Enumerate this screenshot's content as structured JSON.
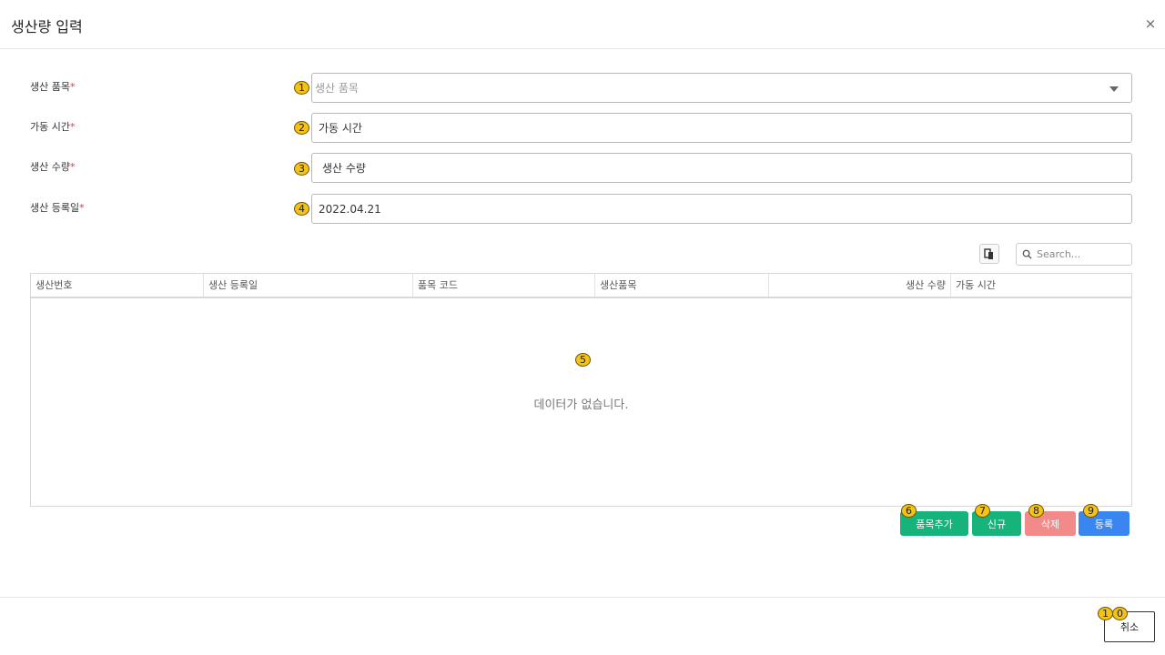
{
  "modal": {
    "title": "생산량 입력",
    "close_label": "×"
  },
  "form": {
    "product": {
      "label": "생산 품목",
      "required_mark": "*",
      "placeholder": "생산 품목",
      "marker": "1"
    },
    "hours": {
      "label": "가동 시간",
      "required_mark": "*",
      "value": "가동 시간",
      "marker": "2"
    },
    "quantity": {
      "label": "생산 수량",
      "required_mark": "*",
      "value": "생산 수량",
      "marker": "3"
    },
    "date": {
      "label": "생산 등록일",
      "required_mark": "*",
      "value": "2022.04.21",
      "marker": "4"
    }
  },
  "toolbar": {
    "export_icon": "export-icon",
    "search_placeholder": "Search...",
    "search_icon": "search-icon"
  },
  "table": {
    "columns": [
      "생산번호",
      "생산 등록일",
      "품목 코드",
      "생산품목",
      "생산 수량",
      "가동 시간"
    ],
    "rows": [],
    "empty_text": "데이터가 없습니다.",
    "marker": "5"
  },
  "actions": {
    "add_item": {
      "label": "품목추가",
      "marker": "6"
    },
    "new": {
      "label": "신규",
      "marker": "7"
    },
    "delete": {
      "label": "삭제",
      "marker": "8"
    },
    "register": {
      "label": "등록",
      "marker": "9"
    }
  },
  "footer": {
    "cancel": {
      "label": "취소",
      "marker_a": "1",
      "marker_b": "0"
    }
  },
  "colors": {
    "green": "#16b47b",
    "red": "#f28a8a",
    "blue": "#3a86f0",
    "badge": "#f5c216",
    "required": "#e03c3c"
  }
}
